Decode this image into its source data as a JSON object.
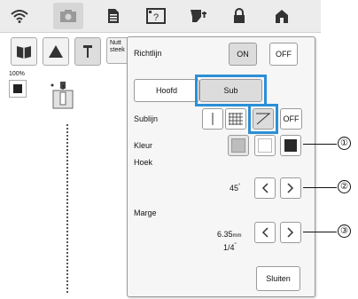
{
  "leftpanel": {
    "nutt_text": "Nutt\nsteek",
    "zoom": "100%"
  },
  "dialog": {
    "richtlijn_label": "Richtlijn",
    "on_label": "ON",
    "off_label": "OFF",
    "tab_hoofd": "Hoofd",
    "tab_sub": "Sub",
    "sublijn_label": "Sublijn",
    "sublijn_off_label": "OFF",
    "kleur_label": "Kleur",
    "hoek_label": "Hoek",
    "hoek_value": "45",
    "hoek_unit": "°",
    "marge_label": "Marge",
    "marge_value_mm": "6.35",
    "marge_unit_mm": "mm",
    "marge_value_in": "1/4",
    "marge_unit_in": "\"",
    "close_label": "Sluiten"
  },
  "callouts": [
    "①",
    "②",
    "③"
  ],
  "colors": {
    "highlight": "#2b8fd6"
  }
}
